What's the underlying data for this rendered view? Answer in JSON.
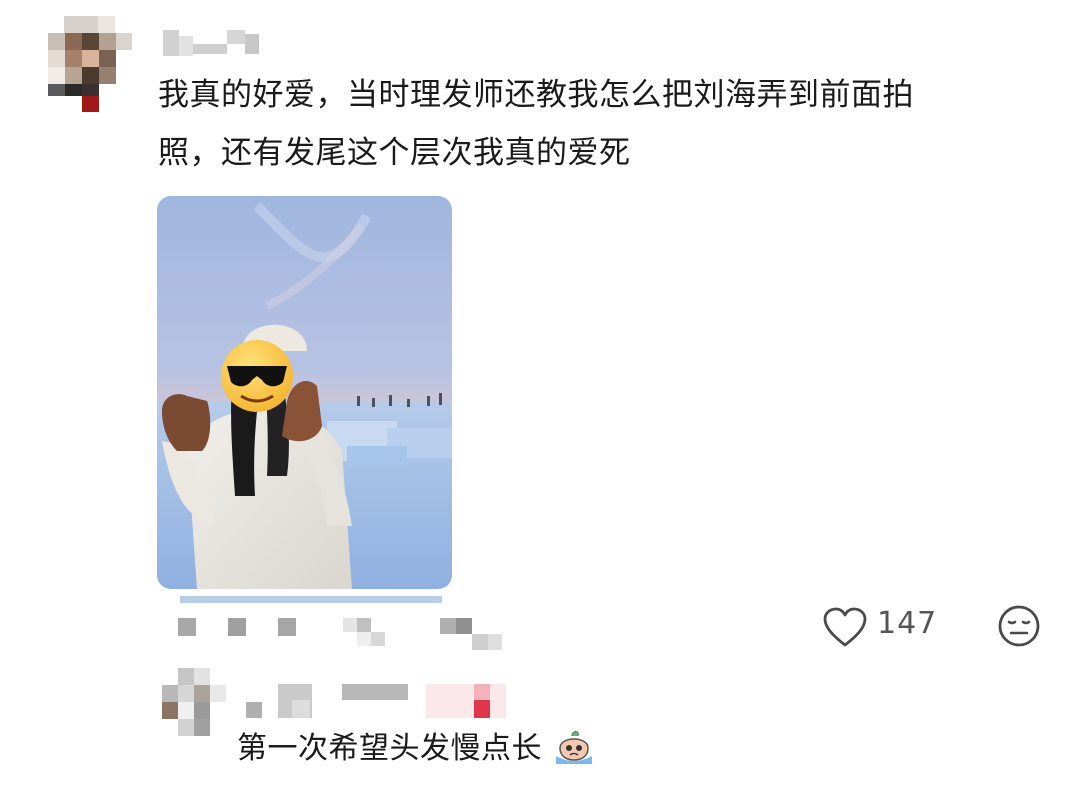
{
  "comment": {
    "text_line1": "我真的好爱，当时理发师还教我怎么把刘海弄到前面拍",
    "text_line2": "照，还有发尾这个层次我真的爱死",
    "likes": "147"
  },
  "reply": {
    "text": "第一次希望头发慢点长"
  },
  "icons": {
    "like": "heart-outline-icon",
    "reaction": "neutral-face-icon",
    "reply_emoji": "crying-face-emoji"
  },
  "colors": {
    "text": "#1a1a1a",
    "muted": "#555555",
    "accent_red": "#e0364a"
  }
}
